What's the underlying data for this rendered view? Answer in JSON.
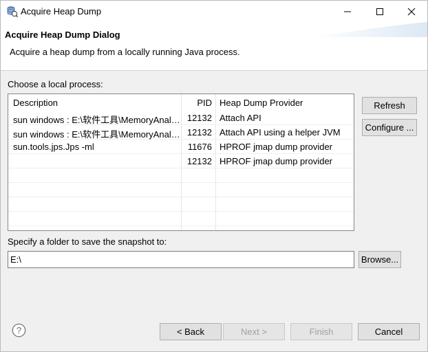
{
  "window": {
    "title": "Acquire Heap Dump"
  },
  "banner": {
    "title": "Acquire Heap Dump Dialog",
    "description": "Acquire a heap dump from a locally running Java process."
  },
  "process": {
    "label": "Choose a local process:",
    "columns": [
      "Description",
      "PID",
      "Heap Dump Provider"
    ],
    "rows": [
      {
        "description": "sun windows : E:\\软件工具\\MemoryAnalyzer",
        "pid": "12132",
        "provider": "Attach API"
      },
      {
        "description": "sun windows : E:\\软件工具\\MemoryAnalyzer",
        "pid": "12132",
        "provider": "Attach API using a helper JVM"
      },
      {
        "description": "sun.tools.jps.Jps -ml",
        "pid": "11676",
        "provider": "HPROF jmap dump provider"
      },
      {
        "description": "",
        "pid": "12132",
        "provider": "HPROF jmap dump provider"
      }
    ]
  },
  "side_buttons": {
    "refresh": "Refresh",
    "configure": "Configure ..."
  },
  "folder": {
    "label": "Specify a folder to save the snapshot to:",
    "value": "E:\\",
    "browse": "Browse..."
  },
  "footer": {
    "back": "< Back",
    "next": "Next >",
    "finish": "Finish",
    "cancel": "Cancel"
  },
  "icons": {
    "app": "heap-dump-icon",
    "help": "help-icon"
  }
}
